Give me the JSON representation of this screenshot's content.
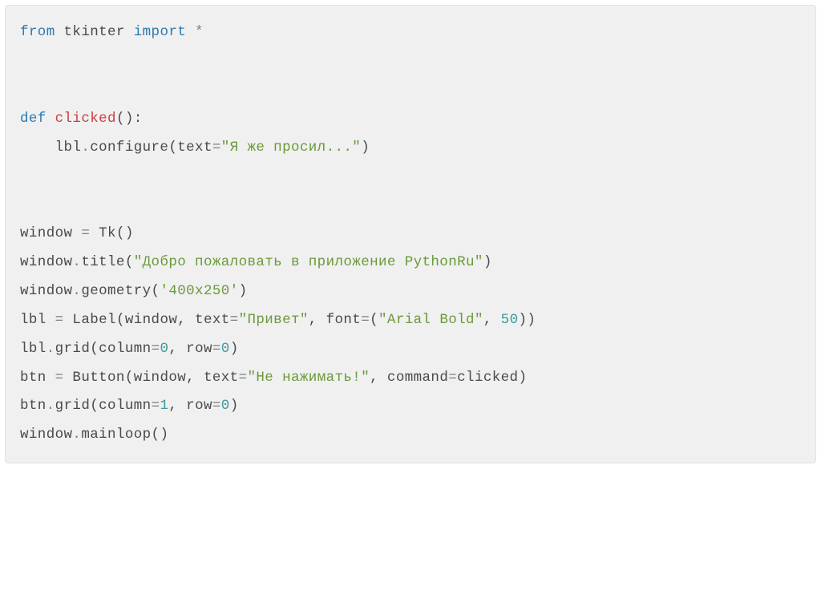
{
  "code": {
    "line1": {
      "from": "from",
      "module": " tkinter ",
      "import": "import",
      "star": " *"
    },
    "line4": {
      "def": "def",
      "space1": " ",
      "funcname": "clicked",
      "parens": "():"
    },
    "line5": {
      "indent": "    lbl",
      "dot": ".",
      "method": "configure",
      "open": "(",
      "param": "text",
      "eq": "=",
      "string": "\"Я же просил...\"",
      "close": ")"
    },
    "line8": {
      "var": "window ",
      "eq": "=",
      "space": " ",
      "call": "Tk",
      "parens": "()"
    },
    "line9": {
      "obj": "window",
      "dot": ".",
      "method": "title",
      "open": "(",
      "string": "\"Добро пожаловать в приложение PythonRu\"",
      "close": ")"
    },
    "line10": {
      "obj": "window",
      "dot": ".",
      "method": "geometry",
      "open": "(",
      "string": "'400x250'",
      "close": ")"
    },
    "line11": {
      "var": "lbl ",
      "eq": "=",
      "space": " ",
      "call": "Label",
      "open": "(",
      "arg1": "window, text",
      "eq2": "=",
      "string": "\"Привет\"",
      "comma": ", font",
      "eq3": "=",
      "open2": "(",
      "string2": "\"Arial Bold\"",
      "comma2": ", ",
      "num": "50",
      "close2": "))"
    },
    "line12": {
      "obj": "lbl",
      "dot": ".",
      "method": "grid",
      "open": "(",
      "p1": "column",
      "eq1": "=",
      "n1": "0",
      "comma": ", row",
      "eq2": "=",
      "n2": "0",
      "close": ")"
    },
    "line13": {
      "var": "btn ",
      "eq": "=",
      "space": " ",
      "call": "Button",
      "open": "(",
      "arg1": "window, text",
      "eq2": "=",
      "string": "\"Не нажимать!\"",
      "comma": ", command",
      "eq3": "=",
      "arg2": "clicked",
      "close": ")"
    },
    "line14": {
      "obj": "btn",
      "dot": ".",
      "method": "grid",
      "open": "(",
      "p1": "column",
      "eq1": "=",
      "n1": "1",
      "comma": ", row",
      "eq2": "=",
      "n2": "0",
      "close": ")"
    },
    "line15": {
      "obj": "window",
      "dot": ".",
      "method": "mainloop",
      "parens": "()"
    }
  }
}
